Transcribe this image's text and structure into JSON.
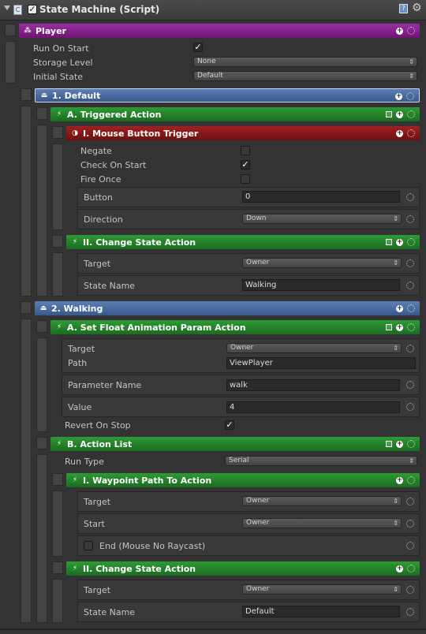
{
  "inspector": {
    "title": "State Machine (Script)"
  },
  "player": {
    "label": "Player",
    "run_on_start": "Run On Start",
    "storage_level": "Storage Level",
    "storage_level_value": "None",
    "initial_state": "Initial State",
    "initial_state_value": "Default"
  },
  "state1": {
    "label": "1. Default",
    "triggered": {
      "label": "A. Triggered Action",
      "trigger": {
        "label": "I. Mouse Button Trigger",
        "negate": "Negate",
        "check_on_start": "Check On Start",
        "fire_once": "Fire Once",
        "button": "Button",
        "button_value": "0",
        "direction": "Direction",
        "direction_value": "Down"
      },
      "change": {
        "label": "II. Change State Action",
        "target": "Target",
        "target_value": "Owner",
        "state_name": "State Name",
        "state_name_value": "Walking"
      }
    }
  },
  "state2": {
    "label": "2. Walking",
    "setfloat": {
      "label": "A. Set Float Animation Param Action",
      "target": "Target",
      "target_value": "Owner",
      "path": "Path",
      "path_value": "ViewPlayer",
      "param": "Parameter Name",
      "param_value": "walk",
      "value": "Value",
      "value_value": "4",
      "revert": "Revert On Stop"
    },
    "actionlist": {
      "label": "B. Action List",
      "run_type": "Run Type",
      "run_type_value": "Serial",
      "waypoint": {
        "label": "I. Waypoint Path To Action",
        "target": "Target",
        "target_value": "Owner",
        "start": "Start",
        "start_value": "Owner",
        "end": "End (Mouse No Raycast)"
      },
      "change": {
        "label": "II. Change State Action",
        "target": "Target",
        "target_value": "Owner",
        "state_name": "State Name",
        "state_name_value": "Default"
      }
    }
  }
}
